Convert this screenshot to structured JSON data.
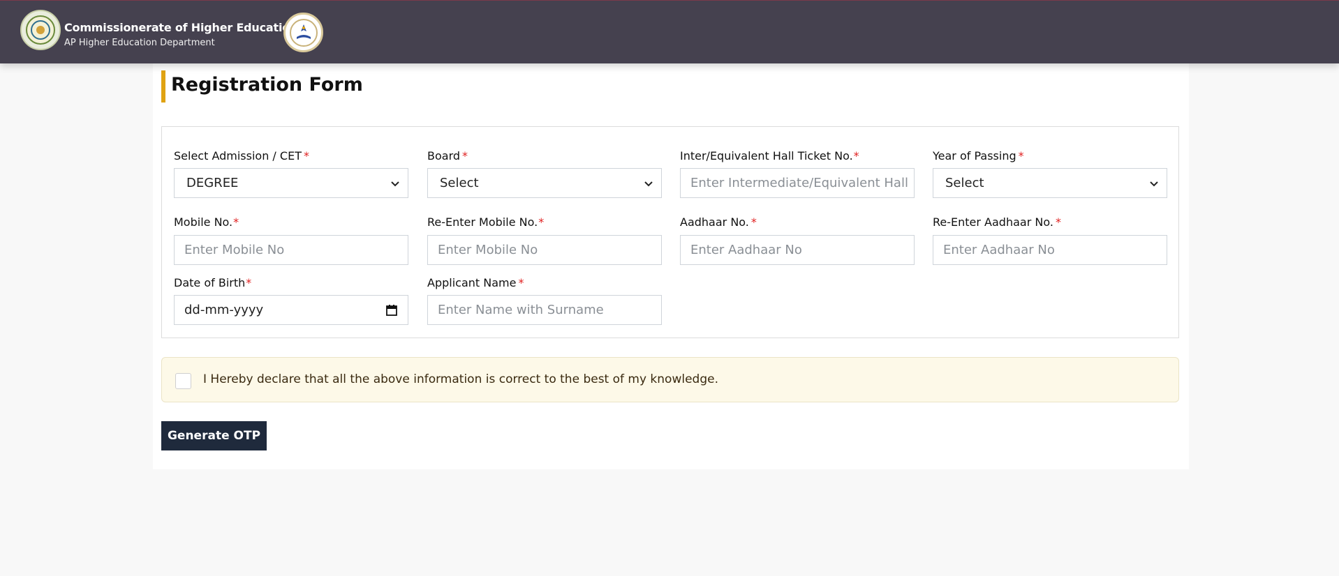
{
  "header": {
    "title": "Commissionerate of Higher Education",
    "subtitle": "AP Higher Education Department"
  },
  "form": {
    "title": "Registration Form",
    "required_mark": "*",
    "fields": {
      "admission": {
        "label": "Select Admission / CET",
        "value": "DEGREE"
      },
      "board": {
        "label": "Board",
        "value": "Select"
      },
      "hall_ticket": {
        "label": "Inter/Equivalent Hall Ticket No.",
        "placeholder": "Enter Intermediate/Equivalent Hall"
      },
      "year_of_passing": {
        "label": "Year of Passing",
        "value": "Select"
      },
      "mobile": {
        "label": "Mobile No.",
        "placeholder": "Enter Mobile No"
      },
      "mobile_confirm": {
        "label": "Re-Enter Mobile No.",
        "placeholder": "Enter Mobile No"
      },
      "aadhaar": {
        "label": "Aadhaar No.",
        "placeholder": "Enter Aadhaar No"
      },
      "aadhaar_confirm": {
        "label": "Re-Enter Aadhaar No.",
        "placeholder": "Enter Aadhaar No"
      },
      "dob": {
        "label": "Date of Birth",
        "placeholder": "dd-mm-yyyy"
      },
      "applicant_name": {
        "label": "Applicant Name",
        "placeholder": "Enter Name with Surname"
      }
    },
    "declaration": "I Hereby declare that all the above information is correct to the best of my knowledge.",
    "declaration_checked": false,
    "submit_label": "Generate OTP"
  },
  "icons": {
    "select_arrow": "chevron-down-icon",
    "date": "calendar-icon"
  },
  "colors": {
    "header_bg": "#45414f",
    "accent": "#e0a312",
    "required": "#e02020",
    "button_bg": "#1f2a3c",
    "declaration_bg": "#fdf9e8"
  }
}
